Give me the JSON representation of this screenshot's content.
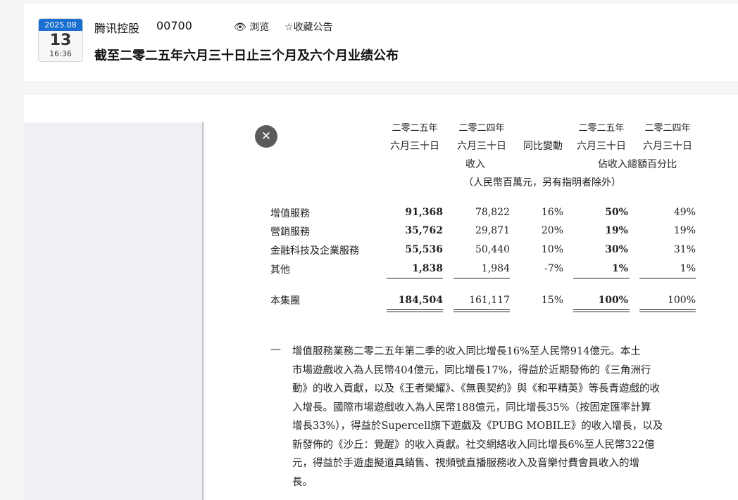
{
  "header": {
    "date_year_month": "2025.08",
    "date_day": "13",
    "time": "16:36",
    "company": "腾讯控股",
    "stock_code": "00700",
    "view_label": "浏览",
    "favorite_label": "收藏公告",
    "title": "截至二零二五年六月三十日止三个月及六个月业绩公布"
  },
  "table": {
    "col_headers": [
      {
        "year": "二零二五年",
        "date": "六月三十日"
      },
      {
        "year": "二零二四年",
        "date": "六月三十日"
      },
      {
        "year": "",
        "date": "同比變動"
      },
      {
        "year": "二零二五年",
        "date": "六月三十日"
      },
      {
        "year": "二零二四年",
        "date": "六月三十日"
      }
    ],
    "group_revenue": "收入",
    "group_percent": "佔收入總額百分比",
    "unit_note": "（人民幣百萬元，另有指明者除外）",
    "rows": [
      {
        "label": "增值服務",
        "v2025": "91,368",
        "v2024": "78,822",
        "yoy": "16%",
        "p2025": "50%",
        "p2024": "49%"
      },
      {
        "label": "營銷服務",
        "v2025": "35,762",
        "v2024": "29,871",
        "yoy": "20%",
        "p2025": "19%",
        "p2024": "19%"
      },
      {
        "label": "金融科技及企業服務",
        "v2025": "55,536",
        "v2024": "50,440",
        "yoy": "10%",
        "p2025": "30%",
        "p2024": "31%"
      },
      {
        "label": "其他",
        "v2025": "1,838",
        "v2024": "1,984",
        "yoy": "-7%",
        "p2025": "1%",
        "p2024": "1%"
      }
    ],
    "total": {
      "label": "本集團",
      "v2025": "184,504",
      "v2024": "161,117",
      "yoy": "15%",
      "p2025": "100%",
      "p2024": "100%"
    }
  },
  "paragraph": {
    "dash": "—",
    "lines": [
      "增值服務業務二零二五年第二季的收入同比增長16%至人民幣914億元。本土",
      "市場遊戲收入為人民幣404億元，同比增長17%，得益於近期發佈的《三角洲行",
      "動》的收入貢獻，以及《王者榮耀》、《無畏契約》與《和平精英》等長青遊戲的收",
      "入增長。國際市場遊戲收入為人民幣188億元，同比增長35%（按固定匯率計算",
      "增長33%），得益於Supercell旗下遊戲及《PUBG MOBILE》的收入增長，以及",
      "新發佈的《沙丘：覺醒》的收入貢獻。社交網絡收入同比增長6%至人民幣322億",
      "元，得益於手遊虛擬道具銷售、視頻號直播服務收入及音樂付費會員收入的增",
      "長。"
    ]
  }
}
